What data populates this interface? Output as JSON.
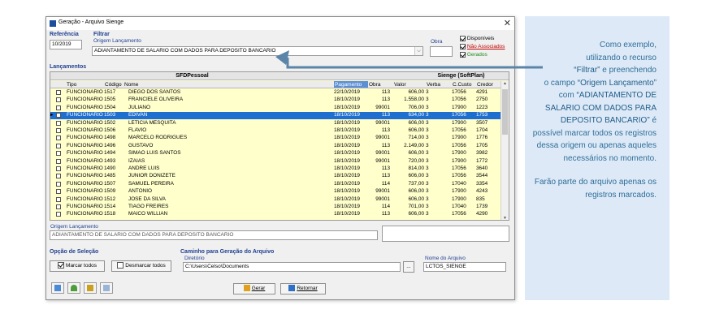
{
  "window": {
    "title": "Geração - Arquivo Sienge",
    "close_label": "✕"
  },
  "filters": {
    "referencia_label": "Referência",
    "referencia_value": "10/2019",
    "filtrar_label": "Filtrar",
    "origem_label": "Origem Lançamento",
    "origem_value": "ADIANTAMENTO DE SALARIO COM DADOS PARA DEPOSITO BANCARIO",
    "obra_label": "Obra",
    "obra_value": "",
    "legend": [
      {
        "label": "Disponíveis",
        "color": "#000000"
      },
      {
        "label": "Não Associados",
        "color": "#c00000"
      },
      {
        "label": "Gerados",
        "color": "#1a8a1a"
      }
    ]
  },
  "grid": {
    "section_label": "Lançamentos",
    "group_left": "SFDPessoal",
    "group_right": "Sienge (SoftPlan)",
    "columns": [
      "Tipo",
      "Código",
      "Nome",
      "Pagamento",
      "Obra",
      "Valor",
      "Verba",
      "C.Custo",
      "Credor"
    ],
    "rows": [
      {
        "tipo": "FUNCIONARIO",
        "codigo": "1517",
        "nome": "DIEGO DOS SANTOS",
        "pagamento": "22/10/2019",
        "obra": "113",
        "valor": "606,00",
        "verba": "3",
        "ccusto": "17056",
        "credor": "4291"
      },
      {
        "tipo": "FUNCIONARIO",
        "codigo": "1505",
        "nome": "FRANCIELE OLIVEIRA",
        "pagamento": "18/10/2019",
        "obra": "113",
        "valor": "1.558,00",
        "verba": "3",
        "ccusto": "17056",
        "credor": "2750"
      },
      {
        "tipo": "FUNCIONARIO",
        "codigo": "1504",
        "nome": "JULIANO",
        "pagamento": "18/10/2019",
        "obra": "99001",
        "valor": "706,00",
        "verba": "3",
        "ccusto": "17900",
        "credor": "1223"
      },
      {
        "tipo": "FUNCIONARIO",
        "codigo": "1503",
        "nome": "EDIVAN",
        "pagamento": "18/10/2019",
        "obra": "113",
        "valor": "634,00",
        "verba": "3",
        "ccusto": "17056",
        "credor": "1753"
      },
      {
        "tipo": "FUNCIONARIO",
        "codigo": "1502",
        "nome": "LETICIA MESQUITA",
        "pagamento": "18/10/2019",
        "obra": "99001",
        "valor": "606,00",
        "verba": "3",
        "ccusto": "17900",
        "credor": "3507"
      },
      {
        "tipo": "FUNCIONARIO",
        "codigo": "1506",
        "nome": "FLAVIO",
        "pagamento": "18/10/2019",
        "obra": "113",
        "valor": "606,00",
        "verba": "3",
        "ccusto": "17056",
        "credor": "1704"
      },
      {
        "tipo": "FUNCIONARIO",
        "codigo": "1498",
        "nome": "MARCELO RODRIGUES",
        "pagamento": "18/10/2019",
        "obra": "99001",
        "valor": "714,00",
        "verba": "3",
        "ccusto": "17900",
        "credor": "1776"
      },
      {
        "tipo": "FUNCIONARIO",
        "codigo": "1496",
        "nome": "GUSTAVO",
        "pagamento": "18/10/2019",
        "obra": "113",
        "valor": "2.149,00",
        "verba": "3",
        "ccusto": "17056",
        "credor": "1705"
      },
      {
        "tipo": "FUNCIONARIO",
        "codigo": "1494",
        "nome": "SIMAO LUIS SANTOS",
        "pagamento": "18/10/2019",
        "obra": "99001",
        "valor": "606,00",
        "verba": "3",
        "ccusto": "17900",
        "credor": "3982"
      },
      {
        "tipo": "FUNCIONARIO",
        "codigo": "1493",
        "nome": "IZAIAS",
        "pagamento": "18/10/2019",
        "obra": "99001",
        "valor": "720,00",
        "verba": "3",
        "ccusto": "17900",
        "credor": "1772"
      },
      {
        "tipo": "FUNCIONARIO",
        "codigo": "1490",
        "nome": "ANDRE LUIS",
        "pagamento": "18/10/2019",
        "obra": "113",
        "valor": "814,00",
        "verba": "3",
        "ccusto": "17056",
        "credor": "3640"
      },
      {
        "tipo": "FUNCIONARIO",
        "codigo": "1485",
        "nome": "JUNIOR DONIZETE",
        "pagamento": "18/10/2019",
        "obra": "113",
        "valor": "606,00",
        "verba": "3",
        "ccusto": "17056",
        "credor": "3544"
      },
      {
        "tipo": "FUNCIONARIO",
        "codigo": "1507",
        "nome": "SAMUEL PEREIRA",
        "pagamento": "18/10/2019",
        "obra": "114",
        "valor": "737,00",
        "verba": "3",
        "ccusto": "17040",
        "credor": "3354"
      },
      {
        "tipo": "FUNCIONARIO",
        "codigo": "1509",
        "nome": "ANTONIO",
        "pagamento": "18/10/2019",
        "obra": "99001",
        "valor": "606,00",
        "verba": "3",
        "ccusto": "17900",
        "credor": "4243"
      },
      {
        "tipo": "FUNCIONARIO",
        "codigo": "1512",
        "nome": "JOSE DA SILVA",
        "pagamento": "18/10/2019",
        "obra": "99001",
        "valor": "606,00",
        "verba": "3",
        "ccusto": "17900",
        "credor": "835"
      },
      {
        "tipo": "FUNCIONARIO",
        "codigo": "1514",
        "nome": "TIAGO FREIRES",
        "pagamento": "18/10/2019",
        "obra": "114",
        "valor": "701,00",
        "verba": "3",
        "ccusto": "17040",
        "credor": "1739"
      },
      {
        "tipo": "FUNCIONARIO",
        "codigo": "1518",
        "nome": "MAICO WILLIAN",
        "pagamento": "18/10/2019",
        "obra": "113",
        "valor": "606,00",
        "verba": "3",
        "ccusto": "17056",
        "credor": "4290"
      }
    ],
    "selected_index": 3,
    "origem_detail_label": "Origem Lançamento",
    "origem_detail_value": "ADIANTAMENTO DE SALARIO COM DADOS PARA DEPOSITO BANCARIO",
    "detail_value": ""
  },
  "selection": {
    "label": "Opção de Seleção",
    "mark_all": "Marcar todos",
    "unmark_all": "Desmarcar todos"
  },
  "path": {
    "label": "Caminho para Geração do Arquivo",
    "dir_label": "Diretório",
    "dir_value": "C:\\Users\\Celso\\Documents",
    "browse_label": "...",
    "file_label": "Nome do Arquivo",
    "file_value": "LCTOS_SIENGE"
  },
  "actions": {
    "generate": "Gerar",
    "back": "Retornar"
  },
  "annotation": {
    "p1_a": "Como exemplo,",
    "p1_b": "utilizando o recurso",
    "p1_c": "“Filtrar”",
    "p1_d": "e preenchendo",
    "p1_e": "o campo",
    "p1_f": "“Origem Lançamento”",
    "p1_g": "com",
    "p1_h": "“ADIANTAMENTO DE SALARIO COM DADOS PARA DEPOSITO BANCARIO”",
    "p1_i": "é possível marcar todos os registros dessa origem ou apenas aqueles necessários no momento.",
    "p2": "Farão parte do arquivo apenas os registros marcados."
  },
  "colors": {
    "grid_bg": "#ffffcc",
    "selection": "#1e6fd0",
    "label_blue": "#1f3f8f",
    "note_bg": "#dde9f6",
    "arrow": "#5a85a8"
  }
}
